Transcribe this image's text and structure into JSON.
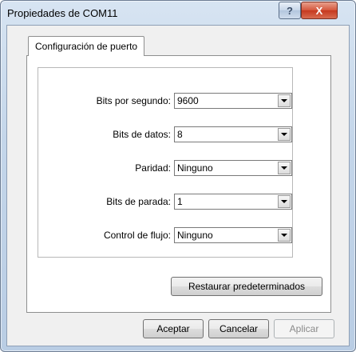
{
  "window": {
    "title": "Propiedades de COM11"
  },
  "tabs": [
    {
      "label": "Configuración de puerto"
    }
  ],
  "fields": [
    {
      "label": "Bits por segundo:",
      "value": "9600"
    },
    {
      "label": "Bits de datos:",
      "value": "8"
    },
    {
      "label": "Paridad:",
      "value": "Ninguno"
    },
    {
      "label": "Bits de parada:",
      "value": "1"
    },
    {
      "label": "Control de flujo:",
      "value": "Ninguno"
    }
  ],
  "restore_label": "Restaurar predeterminados",
  "buttons": {
    "ok": "Aceptar",
    "cancel": "Cancelar",
    "apply": "Aplicar"
  },
  "titlebar": {
    "help_glyph": "?",
    "close_glyph": "X"
  }
}
